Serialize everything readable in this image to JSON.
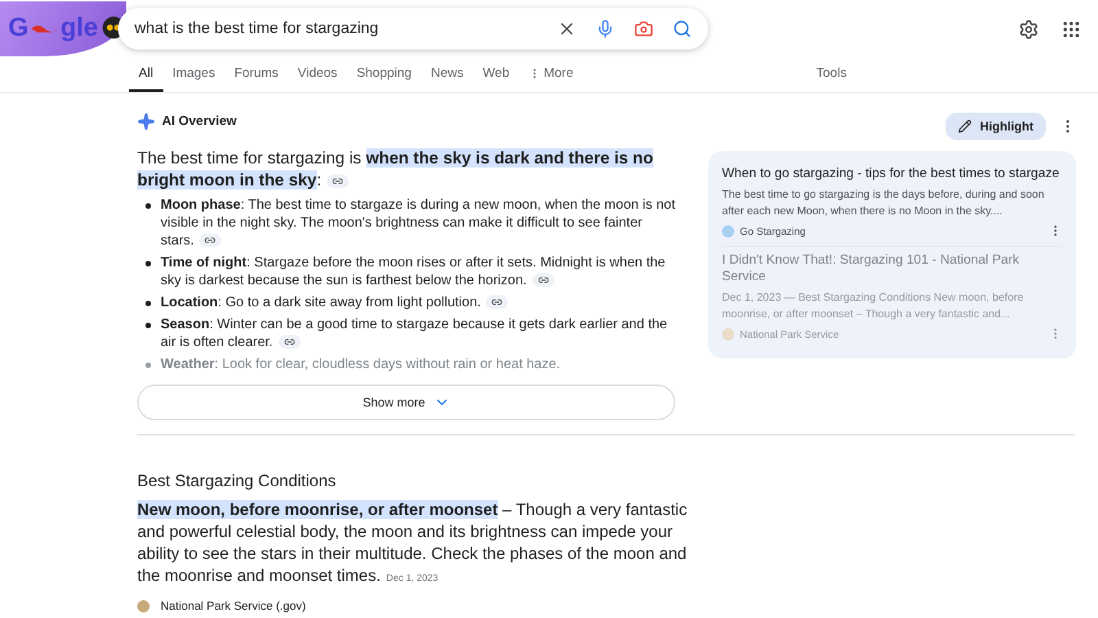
{
  "logo": {
    "parts": [
      "G",
      "gle"
    ]
  },
  "search": {
    "value": "what is the best time for stargazing"
  },
  "tabs": [
    {
      "label": "All",
      "selected": true
    },
    {
      "label": "Images",
      "selected": false
    },
    {
      "label": "Forums",
      "selected": false
    },
    {
      "label": "Videos",
      "selected": false
    },
    {
      "label": "Shopping",
      "selected": false
    },
    {
      "label": "News",
      "selected": false
    },
    {
      "label": "Web",
      "selected": false
    },
    {
      "label": "More",
      "selected": false,
      "kind": "menu"
    }
  ],
  "tools": "Tools",
  "ai_overview": {
    "title": "AI Overview",
    "intro": {
      "lead": "The best time for stargazing is ",
      "highlight": "when the sky is dark and there is no bright moon in the sky",
      "tail": ":"
    },
    "bullets": [
      {
        "term": "Moon phase",
        "text": ": The best time to stargaze is during a new moon, when the moon is not visible in the night sky. The moon's brightness can make it difficult to see fainter stars.",
        "faded": false
      },
      {
        "term": "Time of night",
        "text": ": Stargaze before the moon rises or after it sets. Midnight is when the sky is darkest because the sun is farthest below the horizon.",
        "faded": false
      },
      {
        "term": "Location",
        "text": ": Go to a dark site away from light pollution.",
        "faded": false
      },
      {
        "term": "Season",
        "text": ": Winter can be a good time to stargaze because it gets dark earlier and the air is often clearer.",
        "faded": false
      },
      {
        "term": "Weather",
        "text": ": Look for clear, cloudless days without rain or heat haze.",
        "faded": true
      }
    ],
    "show_more": "Show more",
    "highlight_button": "Highlight",
    "sources": [
      {
        "title": "When to go stargazing - tips for the best times to stargaze",
        "snippet": "The best time to go stargazing is the days before, during and soon after each new Moon, when there is no Moon in the sky....",
        "site": "Go Stargazing",
        "faded": false
      },
      {
        "title": "I Didn't Know That!: Stargazing 101 - National Park Service",
        "snippet": "Dec 1, 2023 — Best Stargazing Conditions New moon, before moonrise, or after moonset – Though a very fantastic and...",
        "site": "National Park Service",
        "faded": true
      }
    ]
  },
  "result": {
    "heading": "Best Stargazing Conditions",
    "highlight": "New moon, before moonrise, or after moonset",
    "text": " – Though a very fantastic and powerful celestial body, the moon and its brightness can impede your ability to see the stars in their multitude. Check the phases of the moon and the moonrise and moonset times.",
    "date": "Dec 1, 2023",
    "site": "National Park Service (.gov)"
  }
}
